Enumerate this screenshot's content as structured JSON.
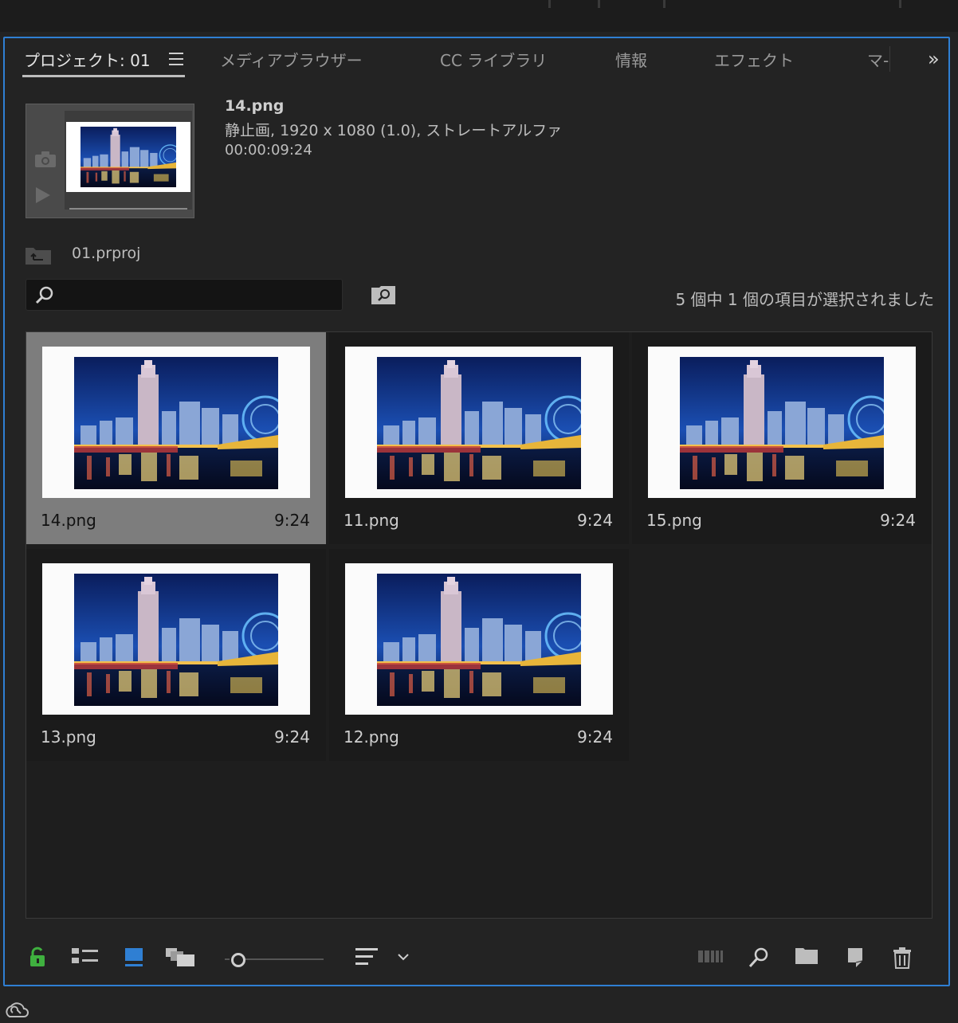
{
  "tabs": [
    {
      "label": "プロジェクト: 01",
      "active": true
    },
    {
      "label": "メディアブラウザー"
    },
    {
      "label": "CC ライブラリ"
    },
    {
      "label": "情報"
    },
    {
      "label": "エフェクト"
    },
    {
      "label": "マ-"
    }
  ],
  "preview": {
    "name": "14.png",
    "meta": "静止画, 1920 x 1080 (1.0), ストレートアルファ",
    "duration": "00:00:09:24"
  },
  "project": {
    "file": "01.prproj"
  },
  "search": {
    "value": "",
    "placeholder": ""
  },
  "selection_status": "5 個中 1 個の項目が選択されました",
  "items": [
    {
      "name": "14.png",
      "duration": "9:24",
      "selected": true
    },
    {
      "name": "11.png",
      "duration": "9:24"
    },
    {
      "name": "15.png",
      "duration": "9:24"
    },
    {
      "name": "13.png",
      "duration": "9:24"
    },
    {
      "name": "12.png",
      "duration": "9:24"
    }
  ],
  "icons": {
    "lock": "lock-icon",
    "list_view": "list-view-icon",
    "icon_view": "icon-view-icon",
    "freeform_view": "freeform-view-icon",
    "zoom_slider": "zoom-slider",
    "sort": "sort-icon",
    "automate": "automate-to-sequence-icon",
    "find": "find-icon",
    "new_bin": "new-bin-icon",
    "new_item": "new-item-icon",
    "clear": "trash-icon",
    "cc": "creative-cloud-icon"
  },
  "colors": {
    "panel_border": "#2f7fd3",
    "background": "#232323",
    "lock_green": "#3fb03f",
    "icon_view_blue": "#2f7fd3",
    "selected_tile": "#7d7d7d"
  },
  "zoom": {
    "level": 0.0
  }
}
